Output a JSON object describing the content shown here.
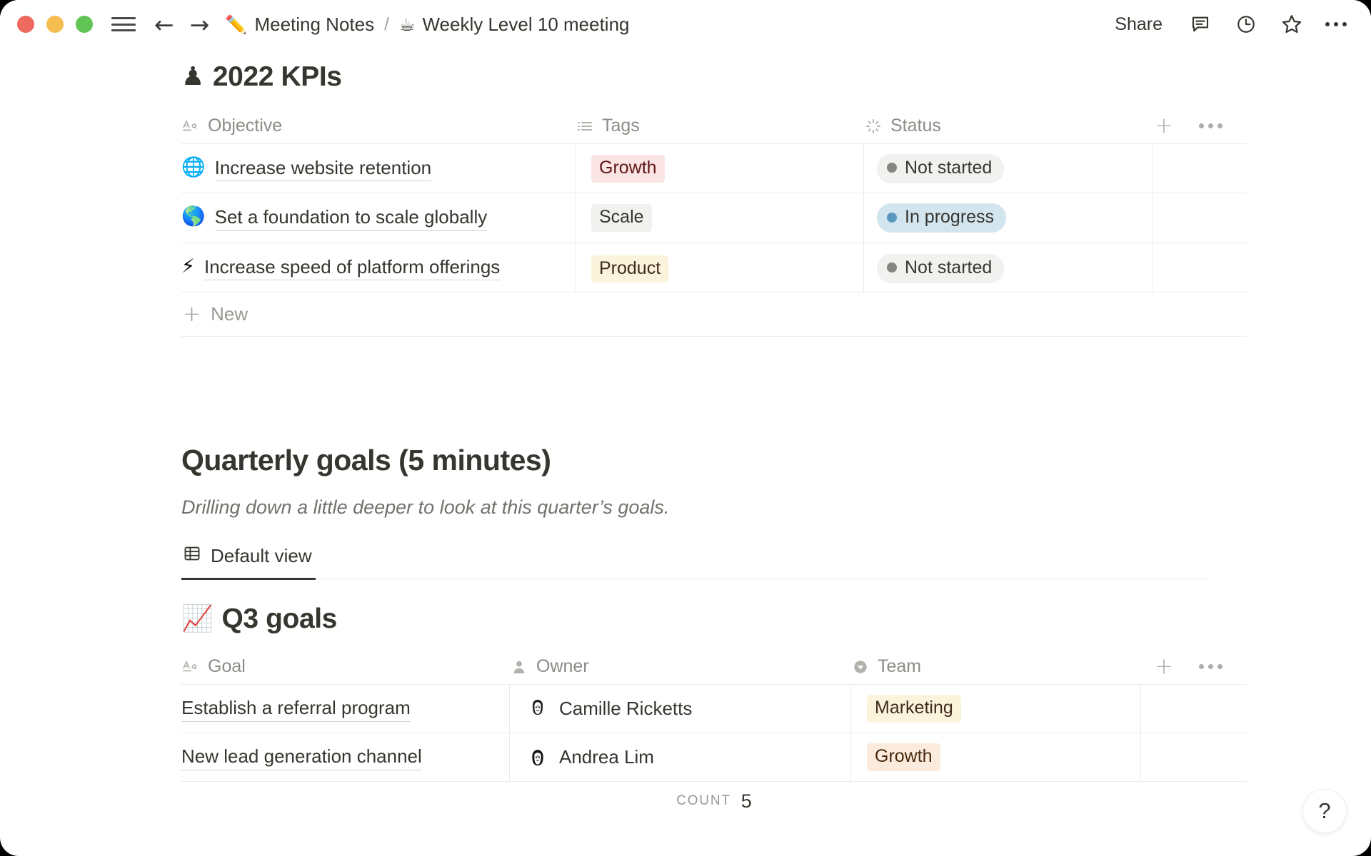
{
  "window": {
    "traffic_lights": [
      "close",
      "minimize",
      "zoom"
    ],
    "colors": {
      "close": "#ee6a5f",
      "minimize": "#f5bd4f",
      "zoom": "#61c454"
    }
  },
  "titlebar": {
    "menu_icon": "hamburger-icon",
    "back_icon": "←",
    "forward_icon": "→",
    "breadcrumb": [
      {
        "emoji": "✏️",
        "label": "Meeting Notes"
      },
      {
        "emoji": "☕",
        "label": "Weekly Level 10 meeting"
      }
    ],
    "separator": "/",
    "share_label": "Share",
    "icons": [
      "comment-icon",
      "history-clock-icon",
      "favorite-star-icon",
      "more-options-icon"
    ]
  },
  "kpi_section": {
    "emoji": "♟",
    "title": "2022 KPIs",
    "columns": [
      {
        "glyph": "title-Aa-icon",
        "label": "Objective"
      },
      {
        "glyph": "multi-select-icon",
        "label": "Tags"
      },
      {
        "glyph": "status-icon",
        "label": "Status"
      }
    ],
    "rows": [
      {
        "emoji": "🌐",
        "objective": "Increase website retention",
        "tag": "Growth",
        "tag_bg": "#fbe4e4",
        "tag_fg": "#5d1715",
        "status": "Not started",
        "status_bg": "#f1f1ef",
        "status_dot": "#868680"
      },
      {
        "emoji": "🌎",
        "objective": "Set a foundation to scale globally",
        "tag": "Scale",
        "tag_bg": "#f1f1ef",
        "tag_fg": "#37352f",
        "status": "In progress",
        "status_bg": "#d3e5ef",
        "status_dot": "#5b97bd"
      },
      {
        "emoji": "⚡",
        "objective": "Increase speed of platform offerings",
        "tag": "Product",
        "tag_bg": "#fbf3db",
        "tag_fg": "#402c1b",
        "status": "Not started",
        "status_bg": "#f1f1ef",
        "status_dot": "#868680"
      }
    ],
    "new_row_label": "New"
  },
  "quarterly": {
    "heading": "Quarterly goals (5 minutes)",
    "description": "Drilling down a little deeper to look at this quarter’s goals.",
    "view_tab": {
      "icon": "table-view-icon",
      "label": "Default view"
    }
  },
  "q3_section": {
    "emoji": "📈",
    "title": "Q3 goals",
    "columns": [
      {
        "glyph": "title-Aa-icon",
        "label": "Goal"
      },
      {
        "glyph": "person-icon",
        "label": "Owner"
      },
      {
        "glyph": "select-icon",
        "label": "Team"
      }
    ],
    "rows": [
      {
        "goal": "Establish a referral program",
        "owner": "Camille Ricketts",
        "team": "Marketing",
        "team_bg": "#fbf3db",
        "team_fg": "#402c1b"
      },
      {
        "goal": "New lead generation channel",
        "owner": "Andrea Lim",
        "team": "Growth",
        "team_bg": "#faebdd",
        "team_fg": "#49290e"
      }
    ],
    "footer": {
      "label": "COUNT",
      "value": "5"
    }
  },
  "help": {
    "label": "?"
  }
}
